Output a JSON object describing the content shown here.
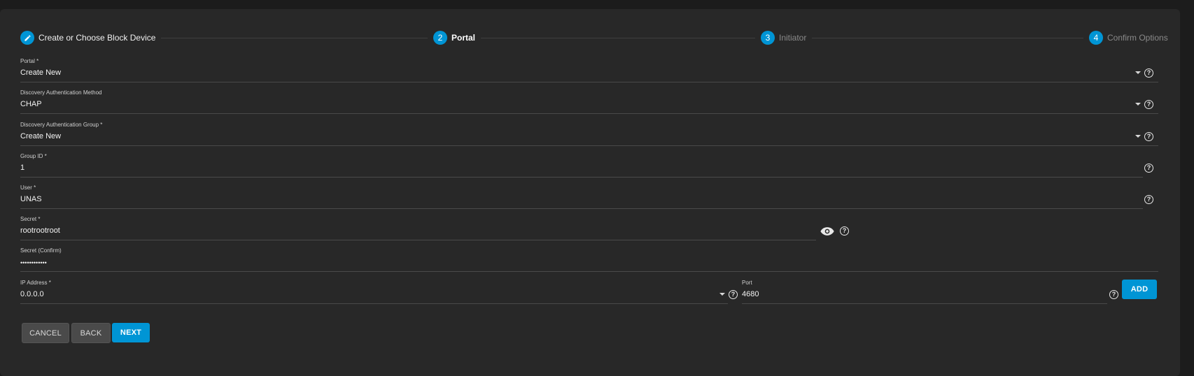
{
  "stepper": {
    "steps": [
      {
        "number": "",
        "label": "Create or Choose Block Device",
        "state": "done"
      },
      {
        "number": "2",
        "label": "Portal",
        "state": "active"
      },
      {
        "number": "3",
        "label": "Initiator",
        "state": "pending"
      },
      {
        "number": "4",
        "label": "Confirm Options",
        "state": "pending"
      }
    ]
  },
  "form": {
    "portal": {
      "label": "Portal *",
      "value": "Create New"
    },
    "discovery_auth_method": {
      "label": "Discovery Authentication Method",
      "value": "CHAP"
    },
    "discovery_auth_group": {
      "label": "Discovery Authentication Group *",
      "value": "Create New"
    },
    "group_id": {
      "label": "Group ID *",
      "value": "1"
    },
    "user": {
      "label": "User *",
      "value": "UNAS"
    },
    "secret": {
      "label": "Secret *",
      "value": "rootrootroot"
    },
    "secret_confirm": {
      "label": "Secret (Confirm)",
      "value": "••••••••••••"
    },
    "ip_address": {
      "label": "IP Address *",
      "value": "0.0.0.0"
    },
    "port": {
      "label": "Port",
      "value": "4680"
    }
  },
  "buttons": {
    "add": "ADD",
    "cancel": "CANCEL",
    "back": "BACK",
    "next": "NEXT"
  },
  "colors": {
    "accent": "#0095d5",
    "background": "#282828",
    "page": "#1c1c1c"
  },
  "icons": {
    "edit": "pencil-icon",
    "dropdown": "caret-down-icon",
    "help": "help-circle-icon",
    "visibility": "eye-icon"
  }
}
